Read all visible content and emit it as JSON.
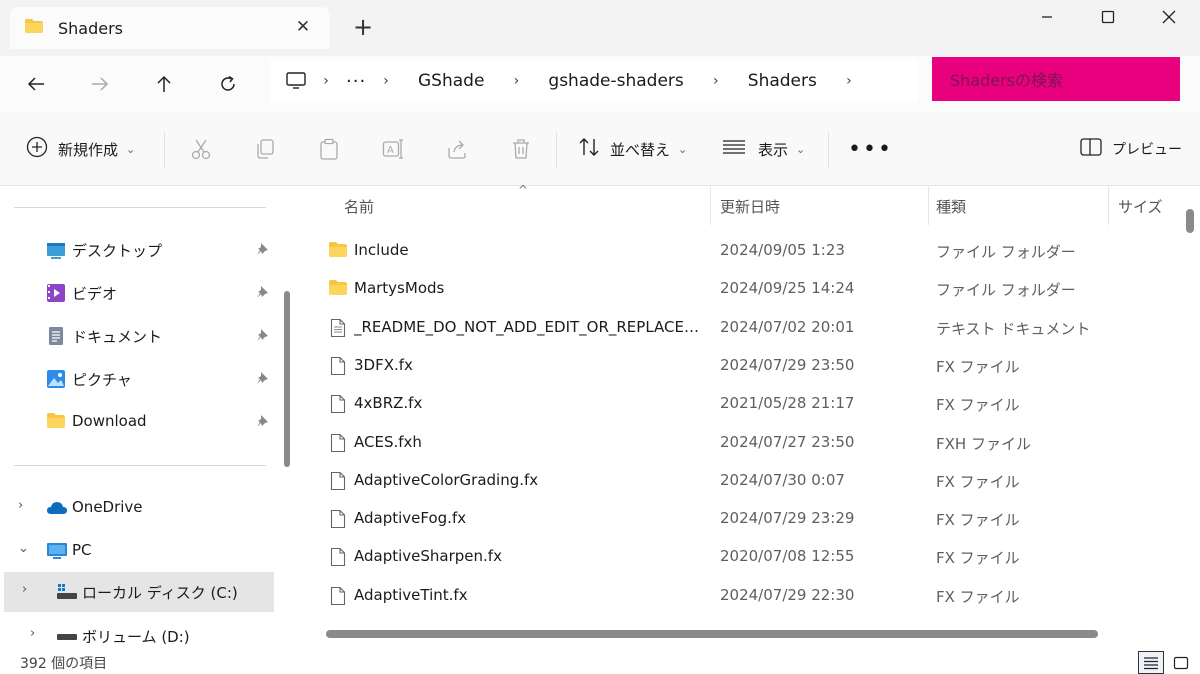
{
  "window": {
    "tab_title": "Shaders",
    "tab_close": "✕",
    "new_tab": "+",
    "min_icon": "minimize-icon",
    "max_icon": "maximize-icon",
    "close_icon": "close-icon"
  },
  "address": {
    "breadcrumbs": [
      "GShade",
      "gshade-shaders",
      "Shaders"
    ],
    "overflow": "···",
    "separator": "›",
    "search_placeholder": "Shadersの検索"
  },
  "toolbar": {
    "new_label": "新規作成",
    "sort_label": "並べ替え",
    "view_label": "表示",
    "more": "•••",
    "preview_label": "プレビュー",
    "caret": "⌄"
  },
  "sidebar": {
    "quick_access": [
      {
        "label": "デスクトップ",
        "icon": "desktop-icon"
      },
      {
        "label": "ビデオ",
        "icon": "videos-icon"
      },
      {
        "label": "ドキュメント",
        "icon": "documents-icon"
      },
      {
        "label": "ピクチャ",
        "icon": "pictures-icon"
      },
      {
        "label": "Download",
        "icon": "folder-icon"
      }
    ],
    "tree": [
      {
        "label": "OneDrive",
        "chevron": "›",
        "icon": "onedrive-icon"
      },
      {
        "label": "PC",
        "chevron": "⌄",
        "icon": "pc-icon"
      },
      {
        "label": "ローカル ディスク (C:)",
        "chevron": "›",
        "icon": "drive-c-icon"
      },
      {
        "label": "ボリューム (D:)",
        "chevron": "›",
        "icon": "drive-icon"
      }
    ]
  },
  "filelist": {
    "columns": [
      "名前",
      "更新日時",
      "種類",
      "サイズ"
    ],
    "sort_indicator": "^",
    "rows": [
      {
        "name": "Include",
        "date": "2024/09/05 1:23",
        "type": "ファイル フォルダー",
        "icon": "folder-icon"
      },
      {
        "name": "MartysMods",
        "date": "2024/09/25 14:24",
        "type": "ファイル フォルダー",
        "icon": "folder-icon"
      },
      {
        "name": "_README_DO_NOT_ADD_EDIT_OR_REPLACE_FI...",
        "date": "2024/07/02 20:01",
        "type": "テキスト ドキュメント",
        "icon": "text-file-icon"
      },
      {
        "name": "3DFX.fx",
        "date": "2024/07/29 23:50",
        "type": "FX ファイル",
        "icon": "file-icon"
      },
      {
        "name": "4xBRZ.fx",
        "date": "2021/05/28 21:17",
        "type": "FX ファイル",
        "icon": "file-icon"
      },
      {
        "name": "ACES.fxh",
        "date": "2024/07/27 23:50",
        "type": "FXH ファイル",
        "icon": "file-icon"
      },
      {
        "name": "AdaptiveColorGrading.fx",
        "date": "2024/07/30 0:07",
        "type": "FX ファイル",
        "icon": "file-icon"
      },
      {
        "name": "AdaptiveFog.fx",
        "date": "2024/07/29 23:29",
        "type": "FX ファイル",
        "icon": "file-icon"
      },
      {
        "name": "AdaptiveSharpen.fx",
        "date": "2020/07/08 12:55",
        "type": "FX ファイル",
        "icon": "file-icon"
      },
      {
        "name": "AdaptiveTint.fx",
        "date": "2024/07/29 22:30",
        "type": "FX ファイル",
        "icon": "file-icon"
      }
    ]
  },
  "status": {
    "item_count": "392 個の項目"
  },
  "colors": {
    "search_highlight": "#e8007f",
    "folder": "#f7c744",
    "accent": "#0067c0"
  }
}
